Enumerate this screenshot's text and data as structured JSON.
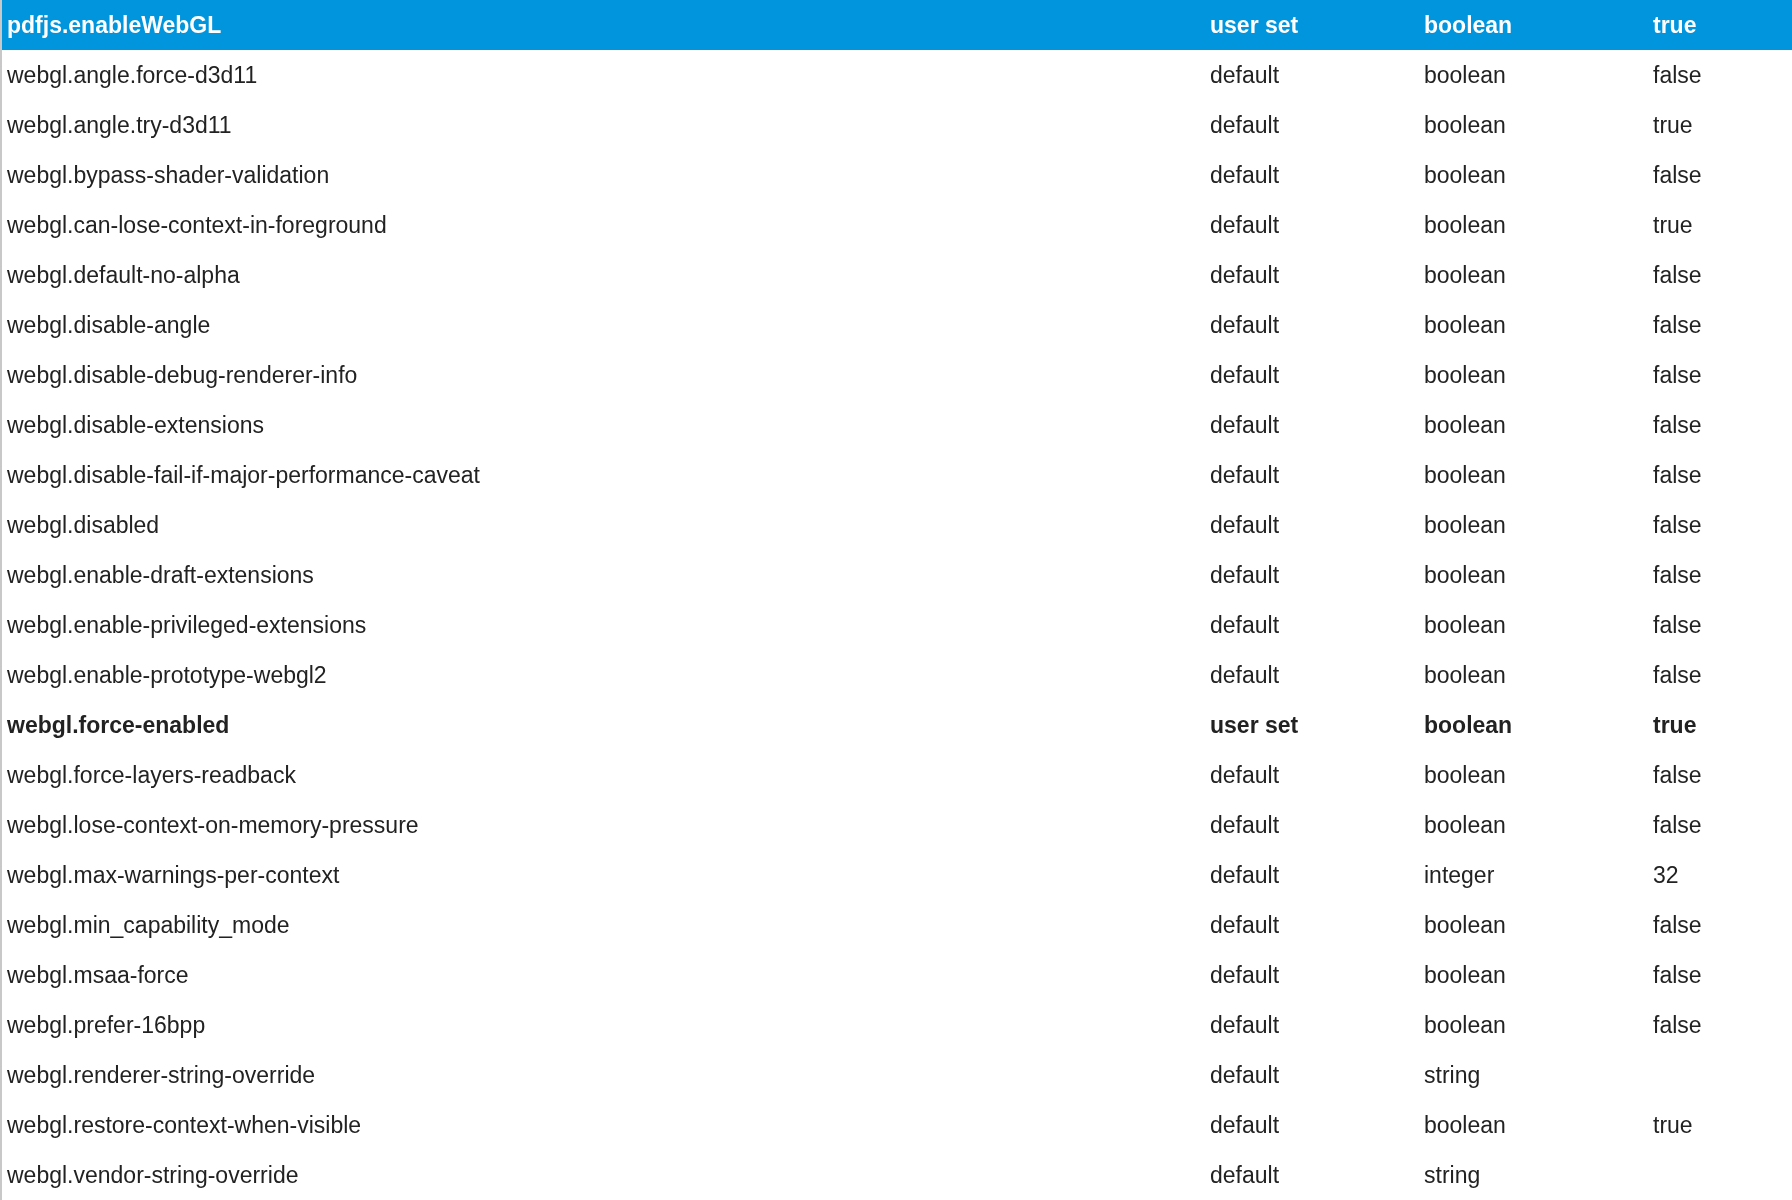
{
  "rows": [
    {
      "name": "pdfjs.enableWebGL",
      "status": "user set",
      "type": "boolean",
      "value": "true",
      "modified": true,
      "selected": true
    },
    {
      "name": "webgl.angle.force-d3d11",
      "status": "default",
      "type": "boolean",
      "value": "false",
      "modified": false,
      "selected": false
    },
    {
      "name": "webgl.angle.try-d3d11",
      "status": "default",
      "type": "boolean",
      "value": "true",
      "modified": false,
      "selected": false
    },
    {
      "name": "webgl.bypass-shader-validation",
      "status": "default",
      "type": "boolean",
      "value": "false",
      "modified": false,
      "selected": false
    },
    {
      "name": "webgl.can-lose-context-in-foreground",
      "status": "default",
      "type": "boolean",
      "value": "true",
      "modified": false,
      "selected": false
    },
    {
      "name": "webgl.default-no-alpha",
      "status": "default",
      "type": "boolean",
      "value": "false",
      "modified": false,
      "selected": false
    },
    {
      "name": "webgl.disable-angle",
      "status": "default",
      "type": "boolean",
      "value": "false",
      "modified": false,
      "selected": false
    },
    {
      "name": "webgl.disable-debug-renderer-info",
      "status": "default",
      "type": "boolean",
      "value": "false",
      "modified": false,
      "selected": false
    },
    {
      "name": "webgl.disable-extensions",
      "status": "default",
      "type": "boolean",
      "value": "false",
      "modified": false,
      "selected": false
    },
    {
      "name": "webgl.disable-fail-if-major-performance-caveat",
      "status": "default",
      "type": "boolean",
      "value": "false",
      "modified": false,
      "selected": false
    },
    {
      "name": "webgl.disabled",
      "status": "default",
      "type": "boolean",
      "value": "false",
      "modified": false,
      "selected": false
    },
    {
      "name": "webgl.enable-draft-extensions",
      "status": "default",
      "type": "boolean",
      "value": "false",
      "modified": false,
      "selected": false
    },
    {
      "name": "webgl.enable-privileged-extensions",
      "status": "default",
      "type": "boolean",
      "value": "false",
      "modified": false,
      "selected": false
    },
    {
      "name": "webgl.enable-prototype-webgl2",
      "status": "default",
      "type": "boolean",
      "value": "false",
      "modified": false,
      "selected": false
    },
    {
      "name": "webgl.force-enabled",
      "status": "user set",
      "type": "boolean",
      "value": "true",
      "modified": true,
      "selected": false
    },
    {
      "name": "webgl.force-layers-readback",
      "status": "default",
      "type": "boolean",
      "value": "false",
      "modified": false,
      "selected": false
    },
    {
      "name": "webgl.lose-context-on-memory-pressure",
      "status": "default",
      "type": "boolean",
      "value": "false",
      "modified": false,
      "selected": false
    },
    {
      "name": "webgl.max-warnings-per-context",
      "status": "default",
      "type": "integer",
      "value": "32",
      "modified": false,
      "selected": false
    },
    {
      "name": "webgl.min_capability_mode",
      "status": "default",
      "type": "boolean",
      "value": "false",
      "modified": false,
      "selected": false
    },
    {
      "name": "webgl.msaa-force",
      "status": "default",
      "type": "boolean",
      "value": "false",
      "modified": false,
      "selected": false
    },
    {
      "name": "webgl.prefer-16bpp",
      "status": "default",
      "type": "boolean",
      "value": "false",
      "modified": false,
      "selected": false
    },
    {
      "name": "webgl.renderer-string-override",
      "status": "default",
      "type": "string",
      "modified": false,
      "selected": false
    },
    {
      "name": "webgl.restore-context-when-visible",
      "status": "default",
      "type": "boolean",
      "value": "true",
      "modified": false,
      "selected": false
    },
    {
      "name": "webgl.vendor-string-override",
      "status": "default",
      "type": "string",
      "modified": false,
      "selected": false
    }
  ]
}
